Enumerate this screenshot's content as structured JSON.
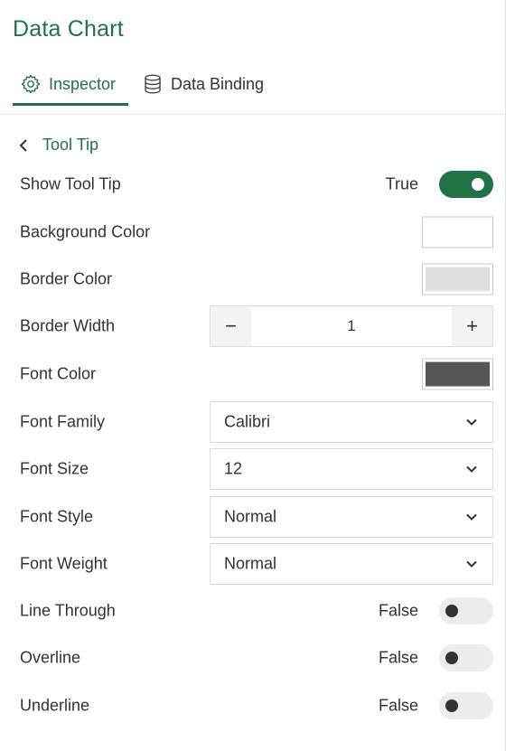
{
  "header": {
    "title": "Data Chart"
  },
  "tabs": [
    {
      "label": "Inspector",
      "icon": "gear-icon",
      "active": true
    },
    {
      "label": "Data Binding",
      "icon": "database-icon",
      "active": false
    }
  ],
  "section": {
    "back_label": "Tool Tip"
  },
  "properties": {
    "show_tool_tip": {
      "label": "Show Tool Tip",
      "value": "True",
      "on": true
    },
    "background_color": {
      "label": "Background Color",
      "color": "#ffffff"
    },
    "border_color": {
      "label": "Border Color",
      "color": "#e0e0e0"
    },
    "border_width": {
      "label": "Border Width",
      "value": "1",
      "minus": "−",
      "plus": "+"
    },
    "font_color": {
      "label": "Font Color",
      "color": "#555555"
    },
    "font_family": {
      "label": "Font Family",
      "value": "Calibri"
    },
    "font_size": {
      "label": "Font Size",
      "value": "12"
    },
    "font_style": {
      "label": "Font Style",
      "value": "Normal"
    },
    "font_weight": {
      "label": "Font Weight",
      "value": "Normal"
    },
    "line_through": {
      "label": "Line Through",
      "value": "False",
      "on": false
    },
    "overline": {
      "label": "Overline",
      "value": "False",
      "on": false
    },
    "underline": {
      "label": "Underline",
      "value": "False",
      "on": false
    }
  },
  "colors": {
    "accent": "#217346",
    "text": "#333333",
    "toggle_off": "#ececec"
  }
}
